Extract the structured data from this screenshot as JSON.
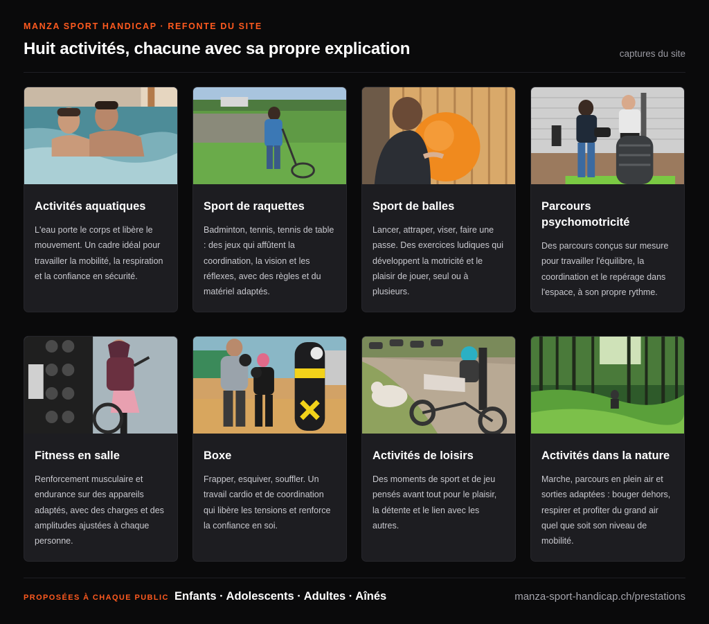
{
  "header": {
    "eyebrow": "MANZA SPORT HANDICAP · REFONTE DU SITE",
    "title": "Huit activités, chacune avec sa propre explication",
    "source": "captures du site"
  },
  "cards": [
    {
      "title": "Activités aquatiques",
      "description": "L'eau porte le corps et libère le mouvement. Un cadre idéal pour travailler la mobilité, la respiration et la confiance en sécurité.",
      "photo": "pool-photo"
    },
    {
      "title": "Sport de raquettes",
      "description": "Badminton, tennis, tennis de table : des jeux qui affûtent la coordination, la vision et les réflexes, avec des règles et du matériel adaptés.",
      "photo": "racket-photo"
    },
    {
      "title": "Sport de balles",
      "description": "Lancer, attraper, viser, faire une passe. Des exercices ludiques qui développent la motricité et le plaisir de jouer, seul ou à plusieurs.",
      "photo": "ball-photo"
    },
    {
      "title": "Parcours psychomotricité",
      "description": "Des parcours conçus sur mesure pour travailler l'équilibre, la coordination et le repérage dans l'espace, à son propre rythme.",
      "photo": "obstacle-course-photo"
    },
    {
      "title": "Fitness en salle",
      "description": "Renforcement musculaire et endurance sur des appareils adaptés, avec des charges et des amplitudes ajustées à chaque personne.",
      "photo": "gym-photo"
    },
    {
      "title": "Boxe",
      "description": "Frapper, esquiver, souffler. Un travail cardio et de coordination qui libère les tensions et renforce la confiance en soi.",
      "photo": "boxing-photo"
    },
    {
      "title": "Activités de loisirs",
      "description": "Des moments de sport et de jeu pensés avant tout pour le plaisir, la détente et le lien avec les autres.",
      "photo": "leisure-photo"
    },
    {
      "title": "Activités dans la nature",
      "description": "Marche, parcours en plein air et sorties adaptées : bouger dehors, respirer et profiter du grand air quel que soit son niveau de mobilité.",
      "photo": "forest-photo"
    }
  ],
  "footer": {
    "label": "PROPOSÉES À CHAQUE PUBLIC",
    "audiences": "Enfants · Adolescents · Adultes · Aînés",
    "link": "manza-sport-handicap.ch/prestations"
  },
  "colors": {
    "accent": "#ff5a1f",
    "background": "#0a0a0b",
    "card": "#1d1d21"
  }
}
